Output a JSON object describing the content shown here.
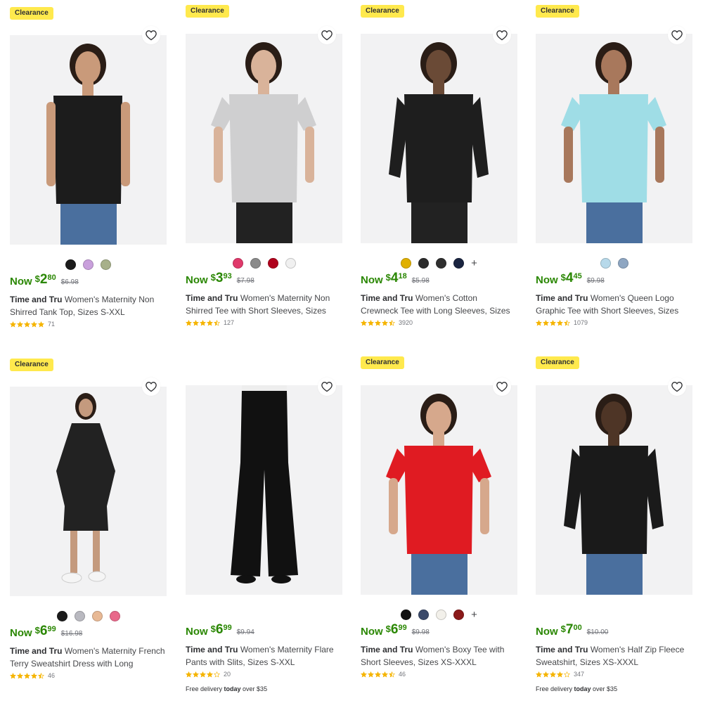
{
  "colors": {
    "accent_green": "#2a8703",
    "badge_yellow": "#ffe94d",
    "star": "#f5b400"
  },
  "products": [
    {
      "badge": "Clearance",
      "swatches": [
        "#1b1b1b",
        "#c9a0dc",
        "#a7b08a"
      ],
      "now_label": "Now",
      "price_dollar": "$",
      "price_whole": "2",
      "price_cents": "80",
      "was_price": "$6.98",
      "brand": "Time and Tru",
      "title": "Women's Maternity Non Shirred Tank Top, Sizes S-XXL",
      "rating": 5,
      "review_count": "71",
      "image_icon": "tank-top-icon"
    },
    {
      "badge": "Clearance",
      "swatches": [
        "#e0396b",
        "#8a8a8a",
        "#b0001c",
        "#f0f0f0"
      ],
      "now_label": "Now",
      "price_dollar": "$",
      "price_whole": "3",
      "price_cents": "93",
      "was_price": "$7.98",
      "brand": "Time and Tru",
      "title": "Women's Maternity Non Shirred Tee with Short Sleeves, Sizes S-...",
      "rating": 4.5,
      "review_count": "127",
      "image_icon": "tee-icon"
    },
    {
      "badge": "Clearance",
      "swatches": [
        "#e0b000",
        "#2b2b2b",
        "#2f2f2f",
        "#1a2440"
      ],
      "more": "+",
      "now_label": "Now",
      "price_dollar": "$",
      "price_whole": "4",
      "price_cents": "18",
      "was_price": "$5.98",
      "brand": "Time and Tru",
      "title": "Women's Cotton Crewneck Tee with Long Sleeves, Sizes XS-XXXL",
      "rating": 4.5,
      "review_count": "3920",
      "image_icon": "long-sleeve-tee-icon"
    },
    {
      "badge": "Clearance",
      "swatches": [
        "#b7d9ea",
        "#8ea6c2"
      ],
      "now_label": "Now",
      "price_dollar": "$",
      "price_whole": "4",
      "price_cents": "45",
      "was_price": "$9.98",
      "brand": "Time and Tru",
      "title": "Women's Queen Logo Graphic Tee with Short Sleeves, Sizes XS...",
      "rating": 4.5,
      "review_count": "1079",
      "image_icon": "graphic-tee-icon"
    },
    {
      "badge": "Clearance",
      "swatches": [
        "#1b1b1b",
        "#b9b9c0",
        "#e8b995",
        "#e8688a"
      ],
      "now_label": "Now",
      "price_dollar": "$",
      "price_whole": "6",
      "price_cents": "99",
      "was_price": "$16.98",
      "brand": "Time and Tru",
      "title": "Women's Maternity French Terry Sweatshirt Dress with Long Sleeve...",
      "rating": 4.5,
      "review_count": "46",
      "image_icon": "dress-icon"
    },
    {
      "badge": "",
      "swatches": [],
      "now_label": "Now",
      "price_dollar": "$",
      "price_whole": "6",
      "price_cents": "99",
      "was_price": "$9.94",
      "brand": "Time and Tru",
      "title": "Women's Maternity Flare Pants with Slits, Sizes S-XXL",
      "rating": 4,
      "review_count": "20",
      "delivery_prefix": "Free delivery ",
      "delivery_bold": "today",
      "delivery_suffix": " over $35",
      "image_icon": "flare-pants-icon"
    },
    {
      "badge": "Clearance",
      "swatches": [
        "#111111",
        "#3b4a6a",
        "#f2f0ea",
        "#8b1a1a"
      ],
      "more": "+",
      "now_label": "Now",
      "price_dollar": "$",
      "price_whole": "6",
      "price_cents": "99",
      "was_price": "$9.98",
      "brand": "Time and Tru",
      "title": "Women's Boxy Tee with Short Sleeves, Sizes XS-XXXL",
      "rating": 4.5,
      "review_count": "46",
      "image_icon": "boxy-tee-icon"
    },
    {
      "badge": "Clearance",
      "swatches": [],
      "now_label": "Now",
      "price_dollar": "$",
      "price_whole": "7",
      "price_cents": "00",
      "was_price": "$10.00",
      "brand": "Time and Tru",
      "title": "Women's Half Zip Fleece Sweatshirt, Sizes XS-XXXL",
      "rating": 4,
      "review_count": "347",
      "delivery_prefix": "Free delivery ",
      "delivery_bold": "today",
      "delivery_suffix": " over $35",
      "image_icon": "half-zip-sweatshirt-icon"
    }
  ]
}
